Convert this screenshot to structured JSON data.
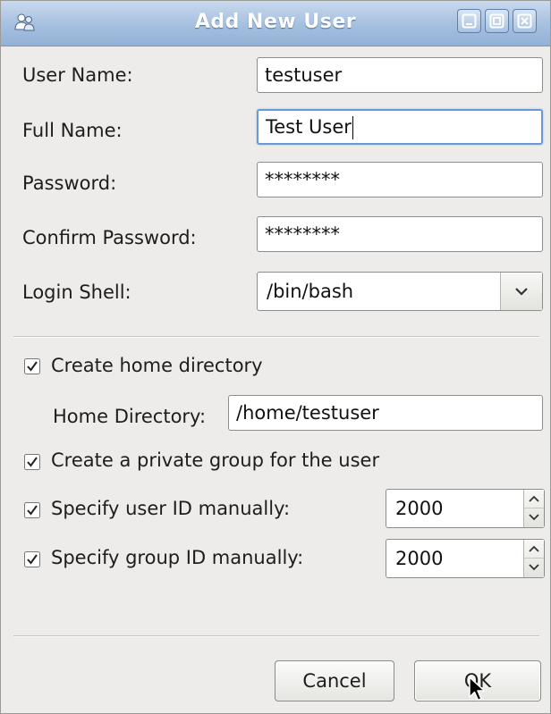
{
  "window": {
    "title": "Add New User"
  },
  "form": {
    "user_name_label": "User Name:",
    "user_name_value": "testuser",
    "full_name_label": "Full Name:",
    "full_name_value": "Test User",
    "password_label": "Password:",
    "password_value": "********",
    "confirm_password_label": "Confirm Password:",
    "confirm_password_value": "********",
    "login_shell_label": "Login Shell:",
    "login_shell_value": "/bin/bash"
  },
  "options": {
    "create_home_label": "Create home directory",
    "create_home_checked": true,
    "home_directory_label": "Home Directory:",
    "home_directory_value": "/home/testuser",
    "private_group_label": "Create a private group for the user",
    "private_group_checked": true,
    "specify_uid_label": "Specify user ID manually:",
    "specify_uid_checked": true,
    "uid_value": "2000",
    "specify_gid_label": "Specify group ID manually:",
    "specify_gid_checked": true,
    "gid_value": "2000"
  },
  "buttons": {
    "cancel_label": "Cancel",
    "ok_label": "OK"
  },
  "icons": {
    "app": "users-icon",
    "minimize": "minimize-icon",
    "maximize": "maximize-icon",
    "close": "close-icon",
    "dropdown": "chevron-down-icon",
    "checkbox": "checkbox-checked-icon",
    "cursor": "mouse-pointer-icon"
  },
  "colors": {
    "titlebar": "#a5bfdf",
    "focus": "#6a9ad4",
    "window_bg": "#edecea"
  }
}
